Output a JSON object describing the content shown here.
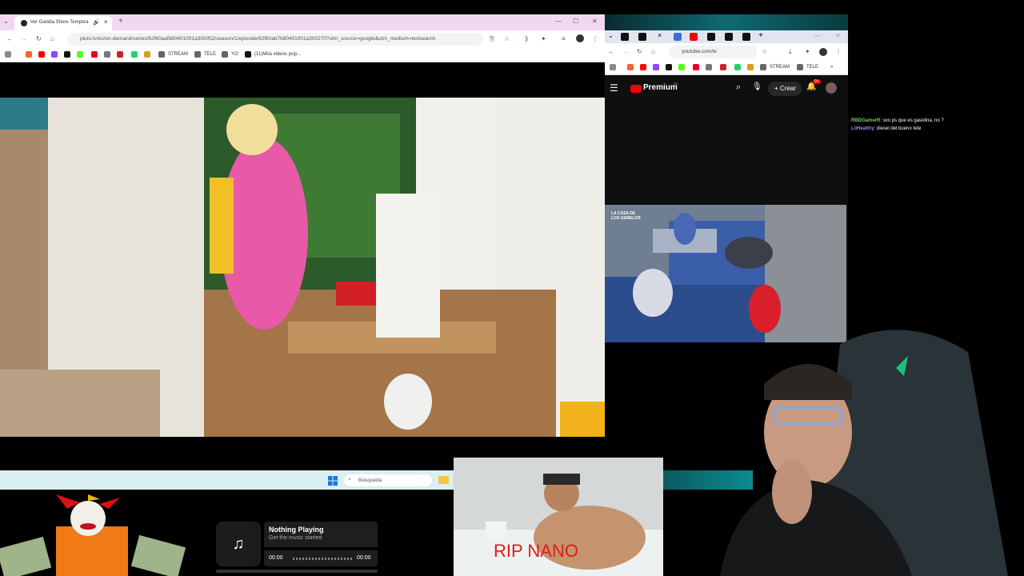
{
  "left_browser": {
    "tab_title": "Ver Gandia Shore Tempora",
    "url": "pluto.tv/es/on-demand/series/62f60aafb80401001a300052/season/1/episode/62f60ab7b80401001a300270?utm_source=google&utm_medium=textsearch",
    "bookmarks": [
      "STREAM",
      "TELE",
      "YO",
      "(11)Mira videos pcip..."
    ]
  },
  "right_browser": {
    "url": "youtube.com/w",
    "bookmarks": [
      "STREAM",
      "TELE"
    ],
    "yt_brand": "Premium",
    "yt_brand_sup": "ES",
    "create_label": "Crear",
    "notif_count": "9+",
    "video_overlay_text": "LA CASA DE LOS GEMELOS"
  },
  "chat": [
    {
      "user": "RBDGamerR",
      "color": "#6fd16f",
      "message": ": sxo ps que es gasolina, no ?"
    },
    {
      "user": "LilHealthy",
      "color": "#b07cff",
      "message": ": diesel del bueno tete"
    }
  ],
  "taskbar": {
    "search_placeholder": "Búsqueda"
  },
  "music": {
    "title": "Nothing Playing",
    "subtitle": "Get the music started",
    "time_start": "00:00",
    "time_end": "00:00",
    "progress": 0
  },
  "overlay_image": {
    "caption": "RIP NANO"
  },
  "colors": {
    "left_tabbar": "#f1d8f0",
    "yt_red": "#ff0000",
    "caption_red": "#e21b1b"
  }
}
